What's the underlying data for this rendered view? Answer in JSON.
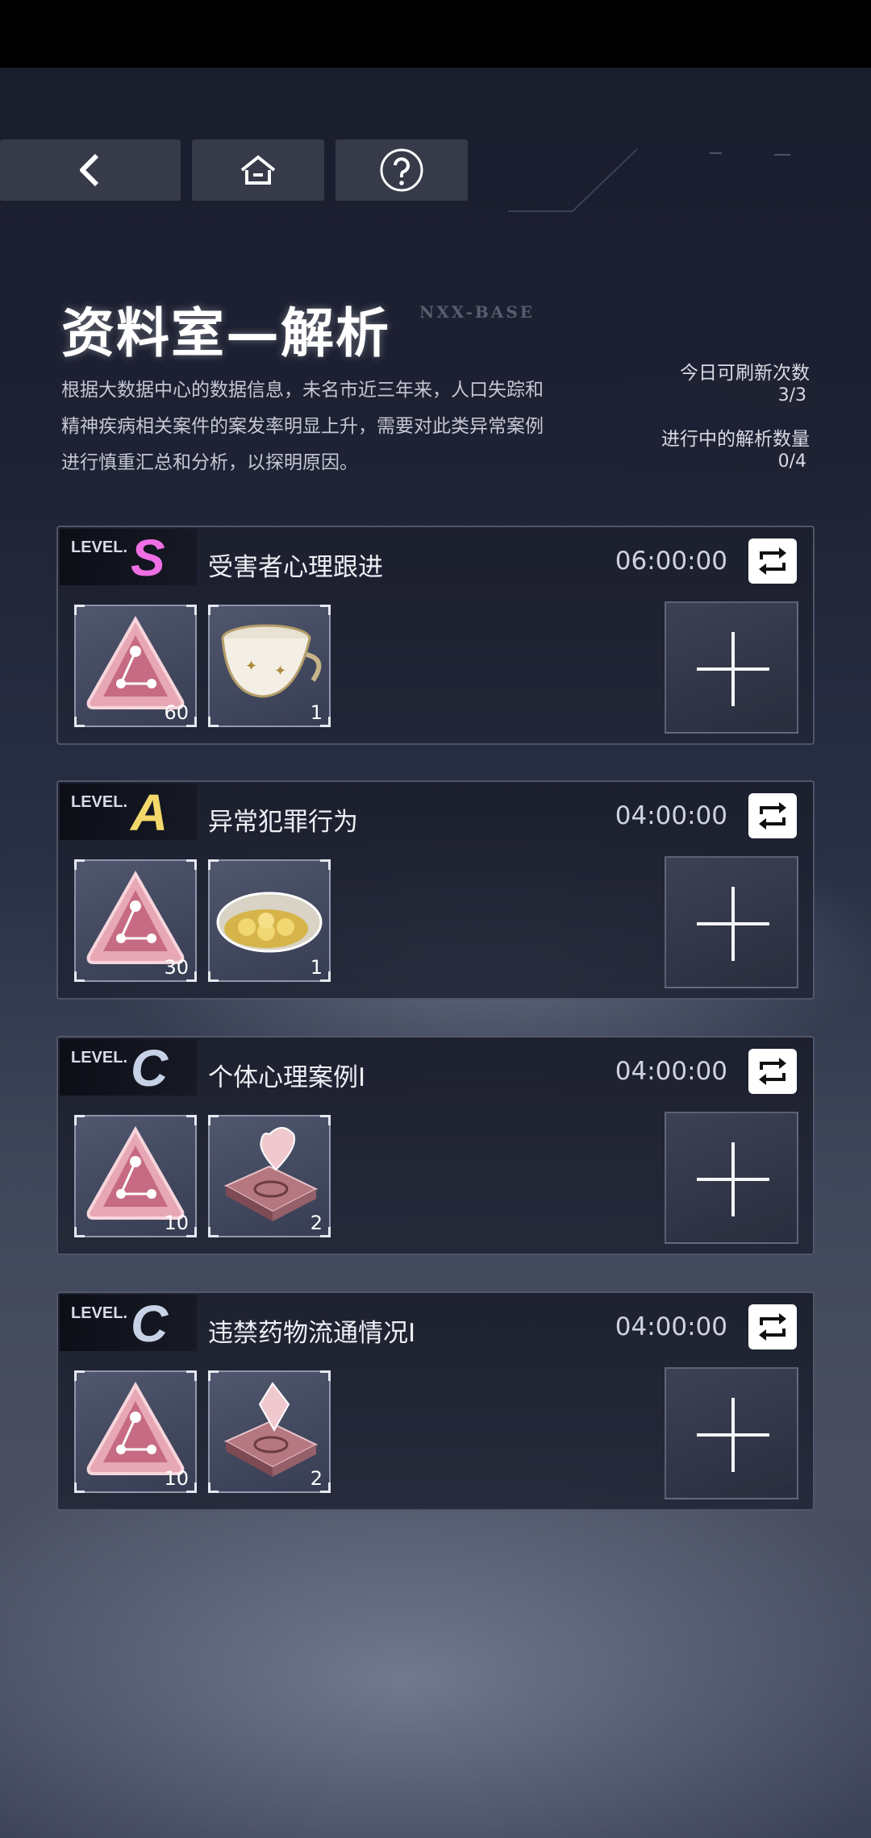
{
  "header": {
    "title": "资料室—解析",
    "subtitle": "NXX-BASE",
    "description": "根据大数据中心的数据信息，未名市近三年来，人口失踪和精神疾病相关案件的案发率明显上升，需要对此类异常案例进行慎重汇总和分析，以探明原因。"
  },
  "nav": {
    "back_icon": "chevron-left-icon",
    "home_icon": "home-icon",
    "help_icon": "question-circle-icon"
  },
  "stats": {
    "refresh_label": "今日可刷新次数",
    "refresh_value": "3/3",
    "active_label": "进行中的解析数量",
    "active_value": "0/4"
  },
  "level_word": "LEVEL.",
  "cards": [
    {
      "level": "S",
      "level_color": "#ee6fe4",
      "title": "受害者心理跟进",
      "timer": "06:00:00",
      "items": [
        {
          "icon": "pink-triangle-chip-icon",
          "qty": "60"
        },
        {
          "icon": "teacup-icon",
          "qty": "1"
        }
      ]
    },
    {
      "level": "A",
      "level_color": "#f2d86a",
      "title": "异常犯罪行为",
      "timer": "04:00:00",
      "items": [
        {
          "icon": "pink-triangle-chip-icon",
          "qty": "30"
        },
        {
          "icon": "gold-coin-dish-icon",
          "qty": "1"
        }
      ]
    },
    {
      "level": "C",
      "level_color": "#c7d2e6",
      "title": "个体心理案例Ⅰ",
      "timer": "04:00:00",
      "items": [
        {
          "icon": "pink-triangle-chip-icon",
          "qty": "10"
        },
        {
          "icon": "heart-crystal-pedestal-icon",
          "qty": "2"
        }
      ]
    },
    {
      "level": "C",
      "level_color": "#c7d2e6",
      "title": "违禁药物流通情况Ⅰ",
      "timer": "04:00:00",
      "items": [
        {
          "icon": "pink-triangle-chip-icon",
          "qty": "10"
        },
        {
          "icon": "diamond-crystal-pedestal-icon",
          "qty": "2"
        }
      ]
    }
  ]
}
